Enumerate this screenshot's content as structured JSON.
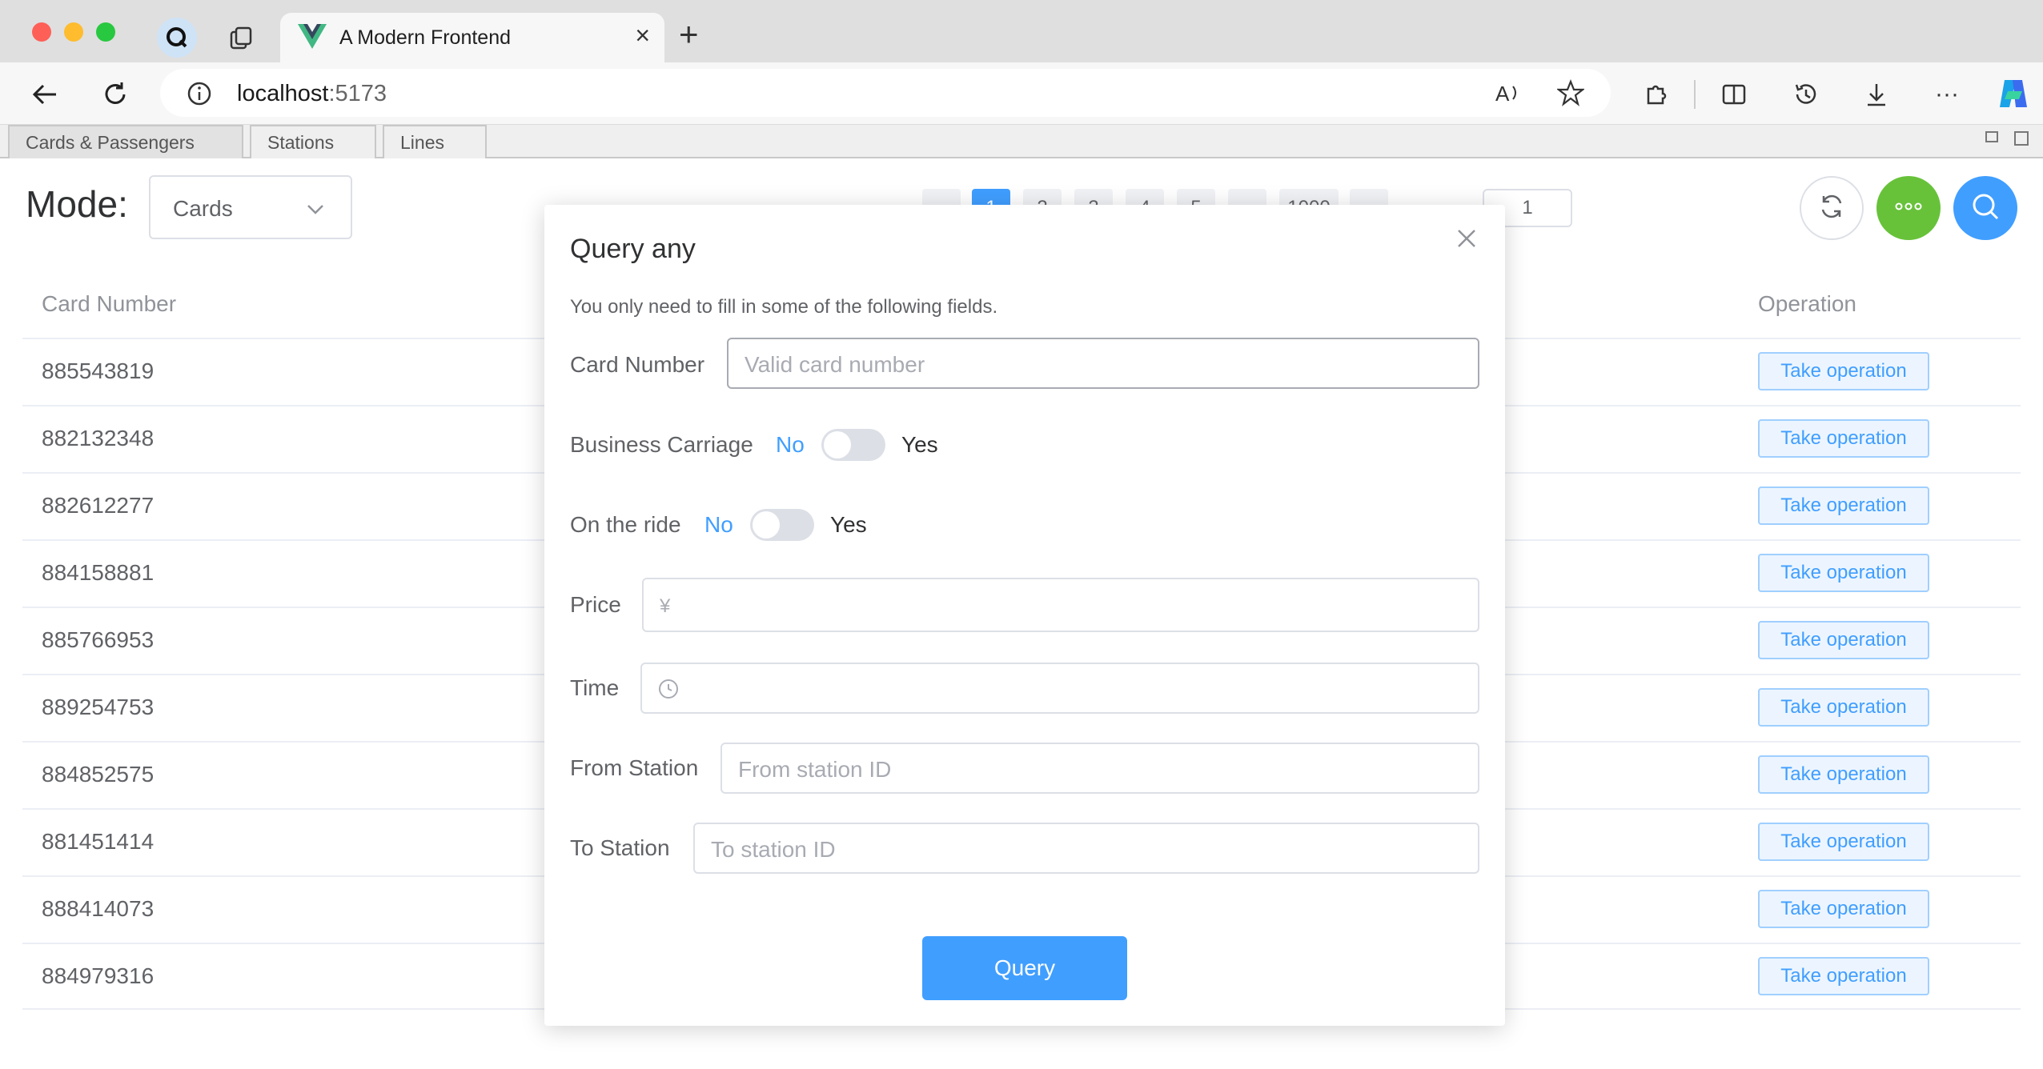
{
  "browser": {
    "tab_title": "A Modern Frontend",
    "url_host": "localhost",
    "url_port": ":5173"
  },
  "app_tabs": [
    {
      "label": "Cards & Passengers"
    },
    {
      "label": "Stations"
    },
    {
      "label": "Lines"
    }
  ],
  "mode": {
    "label": "Mode:",
    "selected": "Cards"
  },
  "pagination": {
    "current_page": "1",
    "pages": [
      "1",
      "2",
      "3",
      "4",
      "5",
      "...",
      "1000"
    ],
    "goto_value": "1"
  },
  "table": {
    "headers": {
      "card_number": "Card Number",
      "operation": "Operation"
    },
    "rows": [
      {
        "card": "885543819",
        "op": "Take operation"
      },
      {
        "card": "882132348",
        "op": "Take operation"
      },
      {
        "card": "882612277",
        "op": "Take operation"
      },
      {
        "card": "884158881",
        "op": "Take operation"
      },
      {
        "card": "885766953",
        "op": "Take operation"
      },
      {
        "card": "889254753",
        "op": "Take operation"
      },
      {
        "card": "884852575",
        "op": "Take operation"
      },
      {
        "card": "881451414",
        "op": "Take operation"
      },
      {
        "card": "888414073",
        "op": "Take operation"
      },
      {
        "card": "884979316",
        "op": "Take operation"
      }
    ]
  },
  "dialog": {
    "title": "Query any",
    "description": "You only need to fill in some of the following fields.",
    "card_number_label": "Card Number",
    "card_number_placeholder": "Valid card number",
    "business_label": "Business Carriage",
    "business_no": "No",
    "business_yes": "Yes",
    "ride_label": "On the ride",
    "ride_no": "No",
    "ride_yes": "Yes",
    "price_label": "Price",
    "price_prefix": "¥",
    "time_label": "Time",
    "from_label": "From Station",
    "from_placeholder": "From station ID",
    "to_label": "To Station",
    "to_placeholder": "To station ID",
    "query_label": "Query"
  },
  "colors": {
    "primary": "#409eff",
    "success": "#67c23a",
    "switch_off": "#dcdfe6"
  }
}
